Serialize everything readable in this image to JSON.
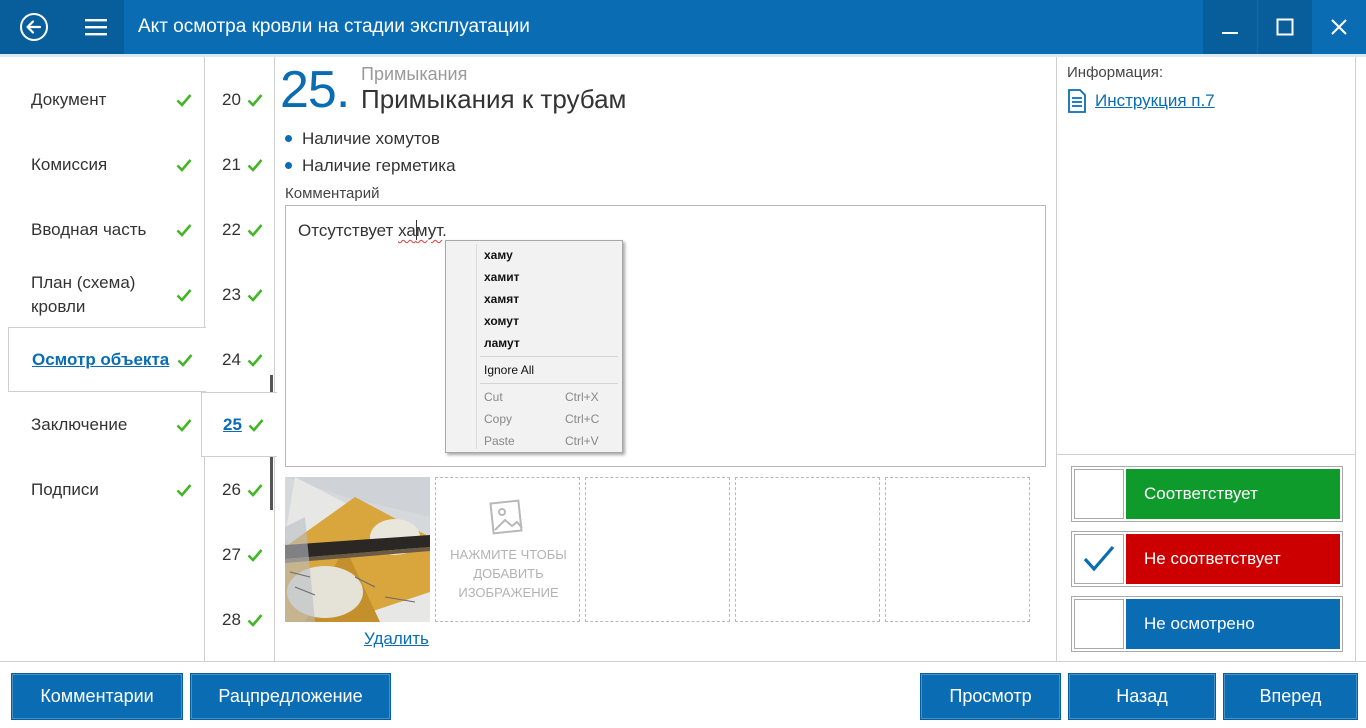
{
  "window": {
    "title": "Акт осмотра кровли на стадии эксплуатации"
  },
  "sidebar": {
    "items": [
      {
        "label": "Документ"
      },
      {
        "label": "Комиссия"
      },
      {
        "label": "Вводная часть"
      },
      {
        "label": "План (схема) кровли"
      },
      {
        "label": "Осмотр объекта",
        "active": true
      },
      {
        "label": "Заключение"
      },
      {
        "label": "Подписи"
      }
    ]
  },
  "numbers": {
    "items": [
      "20",
      "21",
      "22",
      "23",
      "24",
      "25",
      "26",
      "27",
      "28"
    ],
    "active": "25"
  },
  "question": {
    "number": "25.",
    "category": "Примыкания",
    "title": "Примыкания к трубам",
    "bullets": [
      "Наличие хомутов",
      "Наличие герметика"
    ],
    "comment_label": "Комментарий",
    "comment_before": "Отсутствует ",
    "comment_before_caret": "ха",
    "comment_after_caret": "мут",
    "comment_after": "."
  },
  "context_menu": {
    "suggestions": [
      "хаму",
      "хамит",
      "хамят",
      "хомут",
      "ламут"
    ],
    "ignore_all": "Ignore All",
    "edit_items": [
      {
        "label": "Cut",
        "shortcut": "Ctrl+X"
      },
      {
        "label": "Copy",
        "shortcut": "Ctrl+C"
      },
      {
        "label": "Paste",
        "shortcut": "Ctrl+V"
      }
    ]
  },
  "photos": {
    "add_text_line1": "НАЖМИТЕ ЧТОБЫ",
    "add_text_line2": "ДОБАВИТЬ",
    "add_text_line3": "ИЗОБРАЖЕНИЕ",
    "delete_label": "Удалить"
  },
  "info": {
    "label": "Информация:",
    "link": "Инструкция п.7"
  },
  "status": {
    "options": [
      {
        "label": "Соответствует",
        "color": "#0f9a2c",
        "checked": false
      },
      {
        "label": "Не соответствует",
        "color": "#cc0000",
        "checked": true
      },
      {
        "label": "Не осмотрено",
        "color": "#0a6db4",
        "checked": false
      }
    ]
  },
  "bottom": {
    "comments": "Комментарии",
    "proposal": "Рацпредложение",
    "preview": "Просмотр",
    "back": "Назад",
    "forward": "Вперед"
  },
  "colors": {
    "accent": "#0a6db4",
    "check_green": "#44b526"
  }
}
